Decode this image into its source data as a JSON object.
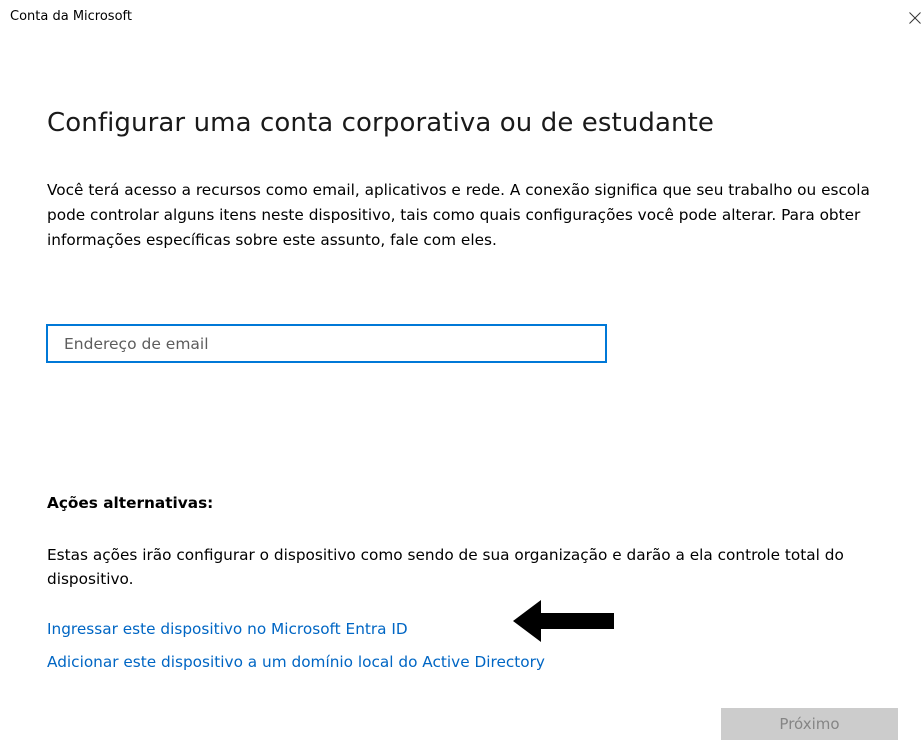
{
  "window": {
    "title": "Conta da Microsoft",
    "close_icon": "close-icon"
  },
  "main": {
    "heading": "Configurar uma conta corporativa ou de estudante",
    "description": "Você terá acesso a recursos como email, aplicativos e rede. A conexão significa que seu trabalho ou escola pode controlar alguns itens neste dispositivo, tais como quais configurações você pode alterar. Para obter informações específicas sobre este assunto, fale com eles.",
    "email_field": {
      "placeholder": "Endereço de email",
      "value": ""
    }
  },
  "alternative_actions": {
    "title": "Ações alternativas:",
    "description": "Estas ações irão configurar o dispositivo como sendo de sua organização e darão a ela controle total do dispositivo.",
    "links": [
      "Ingressar este dispositivo no Microsoft Entra ID",
      "Adicionar este dispositivo a um domínio local do Active Directory"
    ]
  },
  "annotation": {
    "icon": "arrow-left-icon"
  },
  "footer": {
    "next_label": "Próximo",
    "next_enabled": false
  },
  "colors": {
    "accent": "#0078d7",
    "link": "#0066c4",
    "button_disabled_bg": "#cccccc",
    "button_disabled_text": "#858585"
  }
}
